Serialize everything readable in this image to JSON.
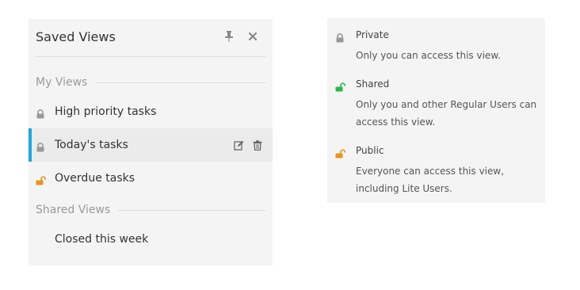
{
  "panel": {
    "title": "Saved Views",
    "pin_icon": "pin-icon",
    "close_icon": "close-icon",
    "my_views_label": "My Views",
    "shared_views_label": "Shared Views",
    "my_views": [
      {
        "label": "High priority tasks",
        "visibility": "private",
        "active": false
      },
      {
        "label": "Today's tasks",
        "visibility": "private",
        "active": true
      },
      {
        "label": "Overdue tasks",
        "visibility": "public",
        "active": false
      }
    ],
    "shared_views": [
      {
        "label": "Closed this week"
      }
    ],
    "row_actions": [
      "edit-icon",
      "delete-icon"
    ]
  },
  "legend": {
    "items": [
      {
        "title": "Private",
        "description": "Only you can access this view.",
        "icon": "lock-closed-icon",
        "color": "#999999"
      },
      {
        "title": "Shared",
        "description": "Only you and other Regular Users can access this view.",
        "icon": "lock-open-icon",
        "color": "#2db84d"
      },
      {
        "title": "Public",
        "description": "Everyone can access this view, including Lite Users.",
        "icon": "lock-open-icon",
        "color": "#e8951e"
      }
    ]
  },
  "colors": {
    "accent": "#1fa6e0",
    "private": "#999999",
    "shared": "#2db84d",
    "public": "#e8951e"
  }
}
